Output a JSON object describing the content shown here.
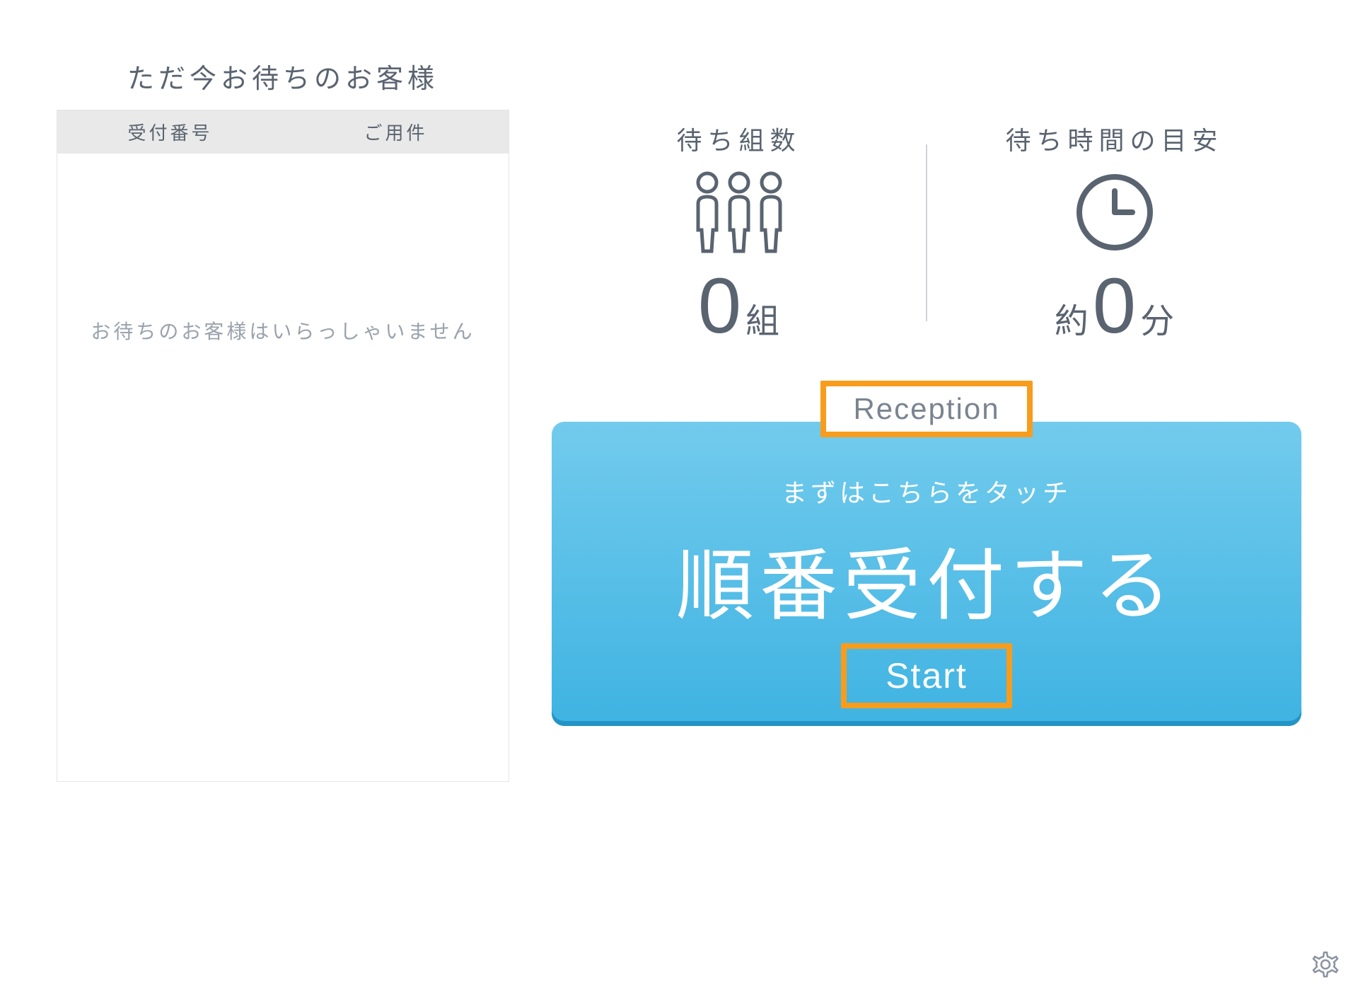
{
  "waiting": {
    "title": "ただ今お待ちのお客様",
    "columns": {
      "receipt_number": "受付番号",
      "purpose": "ご用件"
    },
    "empty_message": "お待ちのお客様はいらっしゃいません"
  },
  "stats": {
    "groups": {
      "label": "待ち組数",
      "value": "0",
      "unit": "組"
    },
    "wait_time": {
      "label": "待ち時間の目安",
      "prefix": "約",
      "value": "0",
      "unit": "分"
    }
  },
  "reception": {
    "label_en": "Reception",
    "hint": "まずはこちらをタッチ",
    "main": "順番受付する",
    "start_en": "Start"
  },
  "colors": {
    "accent_orange": "#f89c1c",
    "button_blue_top": "#72cbed",
    "button_blue_bottom": "#3fb3e2",
    "text_gray": "#5a6470"
  }
}
